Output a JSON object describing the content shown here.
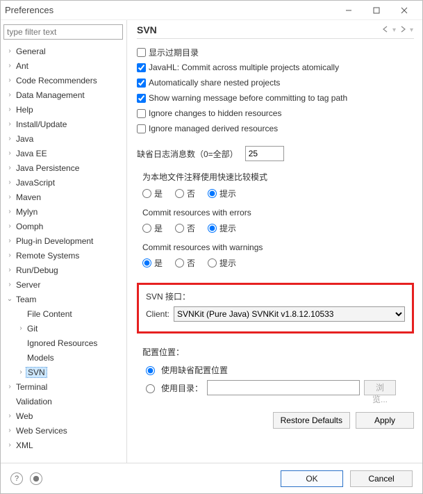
{
  "window": {
    "title": "Preferences",
    "filter_placeholder": "type filter text"
  },
  "tree": {
    "items": [
      {
        "label": "General",
        "expandable": true
      },
      {
        "label": "Ant",
        "expandable": true
      },
      {
        "label": "Code Recommenders",
        "expandable": true
      },
      {
        "label": "Data Management",
        "expandable": true
      },
      {
        "label": "Help",
        "expandable": true
      },
      {
        "label": "Install/Update",
        "expandable": true
      },
      {
        "label": "Java",
        "expandable": true
      },
      {
        "label": "Java EE",
        "expandable": true
      },
      {
        "label": "Java Persistence",
        "expandable": true
      },
      {
        "label": "JavaScript",
        "expandable": true
      },
      {
        "label": "Maven",
        "expandable": true
      },
      {
        "label": "Mylyn",
        "expandable": true
      },
      {
        "label": "Oomph",
        "expandable": true
      },
      {
        "label": "Plug-in Development",
        "expandable": true
      },
      {
        "label": "Remote Systems",
        "expandable": true
      },
      {
        "label": "Run/Debug",
        "expandable": true
      },
      {
        "label": "Server",
        "expandable": true
      },
      {
        "label": "Team",
        "expandable": true,
        "expanded": true,
        "children": [
          {
            "label": "File Content",
            "expandable": false
          },
          {
            "label": "Git",
            "expandable": true
          },
          {
            "label": "Ignored Resources",
            "expandable": false
          },
          {
            "label": "Models",
            "expandable": false
          },
          {
            "label": "SVN",
            "expandable": true,
            "selected": true
          }
        ]
      },
      {
        "label": "Terminal",
        "expandable": true
      },
      {
        "label": "Validation",
        "expandable": false
      },
      {
        "label": "Web",
        "expandable": true
      },
      {
        "label": "Web Services",
        "expandable": true
      },
      {
        "label": "XML",
        "expandable": true
      }
    ]
  },
  "page": {
    "title": "SVN",
    "checks": {
      "show_outdated": {
        "label": "显示过期目录",
        "checked": false
      },
      "javahl": {
        "label": "JavaHL: Commit across multiple projects atomically",
        "checked": true
      },
      "auto_share": {
        "label": "Automatically share nested projects",
        "checked": true
      },
      "warn_tag": {
        "label": "Show warning message before committing to tag path",
        "checked": true
      },
      "ignore_hidden": {
        "label": "Ignore changes to hidden resources",
        "checked": false
      },
      "ignore_derived": {
        "label": "Ignore managed derived resources",
        "checked": false
      }
    },
    "default_log": {
      "label": "缺省日志消息数（0=全部）",
      "value": "25"
    },
    "group_fastcmp": {
      "title": "为本地文件注释使用快速比较模式",
      "opts": {
        "yes": "是",
        "no": "否",
        "prompt": "提示"
      },
      "selected": "prompt"
    },
    "group_err": {
      "title": "Commit resources with errors",
      "opts": {
        "yes": "是",
        "no": "否",
        "prompt": "提示"
      },
      "selected": "prompt"
    },
    "group_warn": {
      "title": "Commit resources with warnings",
      "opts": {
        "yes": "是",
        "no": "否",
        "prompt": "提示"
      },
      "selected": "yes"
    },
    "svn_interface": {
      "group_label": "SVN 接口：",
      "client_label": "Client:",
      "client_value": "SVNKit (Pure Java) SVNKit v1.8.12.10533"
    },
    "config_loc": {
      "group_label": "配置位置：",
      "opt_default": "使用缺省配置位置",
      "opt_dir": "使用目录：",
      "browse": "浏览...",
      "selected": "default"
    },
    "buttons": {
      "restore": "Restore Defaults",
      "apply": "Apply",
      "ok": "OK",
      "cancel": "Cancel"
    }
  }
}
